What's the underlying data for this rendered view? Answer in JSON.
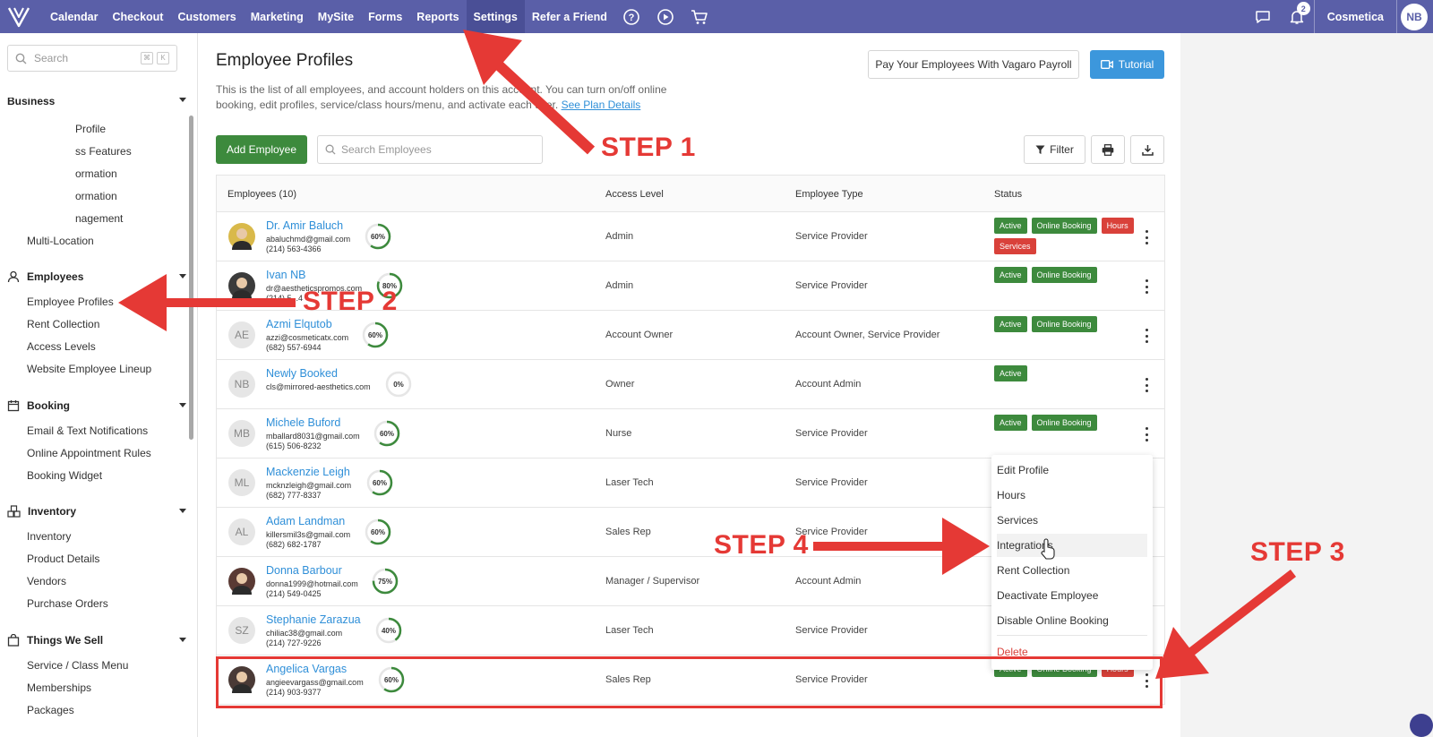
{
  "nav": {
    "items": [
      "Calendar",
      "Checkout",
      "Customers",
      "Marketing",
      "MySite",
      "Forms",
      "Reports",
      "Settings",
      "Refer a Friend"
    ],
    "notification_count": "2",
    "business_name": "Cosmetica",
    "user_initials": "NB"
  },
  "sidebar": {
    "search_placeholder": "Search",
    "search_kbd": [
      "⌘",
      "K"
    ],
    "business_header": "Business",
    "business_items": [
      "Profile",
      "ss Features",
      "ormation",
      "ormation",
      "nagement",
      "Multi-Location"
    ],
    "employees_header": "Employees",
    "employees_items": [
      "Employee Profiles",
      "Rent Collection",
      "Access Levels",
      "Website Employee Lineup"
    ],
    "booking_header": "Booking",
    "booking_items": [
      "Email & Text Notifications",
      "Online Appointment Rules",
      "Booking Widget"
    ],
    "inventory_header": "Inventory",
    "inventory_items": [
      "Inventory",
      "Product Details",
      "Vendors",
      "Purchase Orders"
    ],
    "things_header": "Things We Sell",
    "things_items": [
      "Service / Class Menu",
      "Memberships",
      "Packages"
    ]
  },
  "page": {
    "title": "Employee Profiles",
    "description": "This is the list of all employees, and account holders on this account. You can turn on/off online booking, edit profiles, service/class hours/menu, and activate each user.",
    "description_link": "See Plan Details",
    "payroll_button": "Pay Your Employees With Vagaro Payroll",
    "tutorial_button": "Tutorial",
    "add_button": "Add Employee",
    "search_placeholder": "Search Employees",
    "filter_button": "Filter"
  },
  "table": {
    "headers": [
      "Employees (10)",
      "Access Level",
      "Employee Type",
      "Status"
    ],
    "rows": [
      {
        "name": "Dr. Amir Baluch",
        "email": "abaluchmd@gmail.com",
        "phone": "(214) 563-4366",
        "pct": "60%",
        "pct_value": 60,
        "access": "Admin",
        "type": "Service Provider",
        "initials": "",
        "photo": true,
        "badges": [
          [
            "Active",
            "green"
          ],
          [
            "Online Booking",
            "green"
          ],
          [
            "Hours",
            "red"
          ],
          [
            "Services",
            "red"
          ]
        ]
      },
      {
        "name": "Ivan NB",
        "email": "dr@aestheticspromos.com",
        "phone": "(214) 5...4",
        "pct": "80%",
        "pct_value": 80,
        "access": "Admin",
        "type": "Service Provider",
        "initials": "",
        "photo": true,
        "badges": [
          [
            "Active",
            "green"
          ],
          [
            "Online Booking",
            "green"
          ]
        ]
      },
      {
        "name": "Azmi Elqutob",
        "email": "azzi@cosmeticatx.com",
        "phone": "(682) 557-6944",
        "pct": "60%",
        "pct_value": 60,
        "access": "Account Owner",
        "type": "Account Owner, Service Provider",
        "initials": "AE",
        "photo": false,
        "badges": [
          [
            "Active",
            "green"
          ],
          [
            "Online Booking",
            "green"
          ]
        ]
      },
      {
        "name": "Newly Booked",
        "email": "cls@mirrored-aesthetics.com",
        "phone": "",
        "pct": "0%",
        "pct_value": 0,
        "access": "Owner",
        "type": "Account Admin",
        "initials": "NB",
        "photo": false,
        "badges": [
          [
            "Active",
            "green"
          ]
        ]
      },
      {
        "name": "Michele Buford",
        "email": "mballard8031@gmail.com",
        "phone": "(615) 506-8232",
        "pct": "60%",
        "pct_value": 60,
        "access": "Nurse",
        "type": "Service Provider",
        "initials": "MB",
        "photo": false,
        "badges": [
          [
            "Active",
            "green"
          ],
          [
            "Online Booking",
            "green"
          ]
        ]
      },
      {
        "name": "Mackenzie Leigh",
        "email": "mcknzleigh@gmail.com",
        "phone": "(682) 777-8337",
        "pct": "60%",
        "pct_value": 60,
        "access": "Laser Tech",
        "type": "Service Provider",
        "initials": "ML",
        "photo": false,
        "badges": []
      },
      {
        "name": "Adam Landman",
        "email": "killersmil3s@gmail.com",
        "phone": "(682) 682-1787",
        "pct": "60%",
        "pct_value": 60,
        "access": "Sales Rep",
        "type": "Service Provider",
        "initials": "AL",
        "photo": false,
        "badges": []
      },
      {
        "name": "Donna Barbour",
        "email": "donna1999@hotmail.com",
        "phone": "(214) 549-0425",
        "pct": "75%",
        "pct_value": 75,
        "access": "Manager / Supervisor",
        "type": "Account Admin",
        "initials": "",
        "photo": true,
        "badges": []
      },
      {
        "name": "Stephanie Zarazua",
        "email": "chiliac38@gmail.com",
        "phone": "(214) 727-9226",
        "pct": "40%",
        "pct_value": 40,
        "access": "Laser Tech",
        "type": "Service Provider",
        "initials": "SZ",
        "photo": false,
        "badges": []
      },
      {
        "name": "Angelica Vargas",
        "email": "angieevargass@gmail.com",
        "phone": "(214) 903-9377",
        "pct": "60%",
        "pct_value": 60,
        "access": "Sales Rep",
        "type": "Service Provider",
        "initials": "",
        "photo": true,
        "badges": [
          [
            "Active",
            "green"
          ],
          [
            "Online Booking",
            "green"
          ],
          [
            "Hours",
            "red"
          ]
        ]
      }
    ]
  },
  "menu": {
    "items": [
      "Edit Profile",
      "Hours",
      "Services",
      "Integrations",
      "Rent Collection",
      "Deactivate Employee",
      "Disable Online Booking",
      "Delete"
    ]
  },
  "annotations": {
    "step1": "STEP 1",
    "step2": "STEP 2",
    "step3": "STEP 3",
    "step4": "STEP 4"
  },
  "colors": {
    "nav": "#5a5fa8",
    "primary_green": "#3d8a3d",
    "link_blue": "#2f8fd8",
    "badge_red": "#d9413a",
    "annotation_red": "#e53935"
  }
}
